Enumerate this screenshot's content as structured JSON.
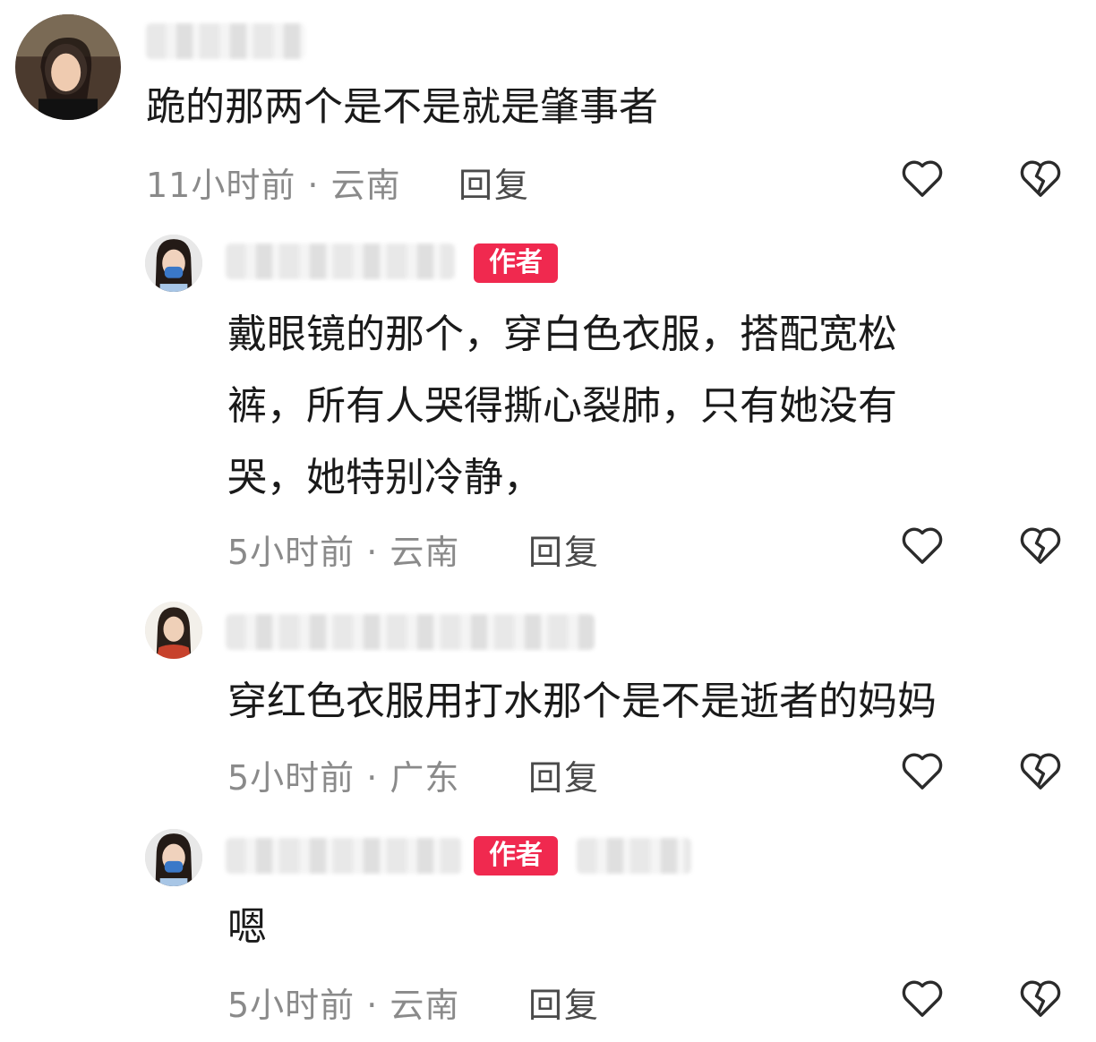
{
  "comments": [
    {
      "text": "跪的那两个是不是就是肇事者",
      "time_location": "11小时前 · 云南",
      "reply_label": "回复",
      "is_author": false
    },
    {
      "text": "戴眼镜的那个，穿白色衣服，搭配宽松\n裤，所有人哭得撕心裂肺，只有她没有\n哭，她特别冷静，",
      "time_location": "5小时前 · 云南",
      "reply_label": "回复",
      "is_author": true,
      "author_badge": "作者"
    },
    {
      "text": "穿红色衣服用打水那个是不是逝者的妈妈",
      "time_location": "5小时前 · 广东",
      "reply_label": "回复",
      "is_author": false
    },
    {
      "text": "嗯",
      "time_location": "5小时前 · 云南",
      "reply_label": "回复",
      "is_author": true,
      "author_badge": "作者"
    }
  ],
  "icons": {
    "like": "heart-outline-icon",
    "dislike": "broken-heart-icon"
  },
  "colors": {
    "author_badge": "#f0294f",
    "meta_text": "#8a8a8a",
    "body_text": "#1a1a1a"
  }
}
